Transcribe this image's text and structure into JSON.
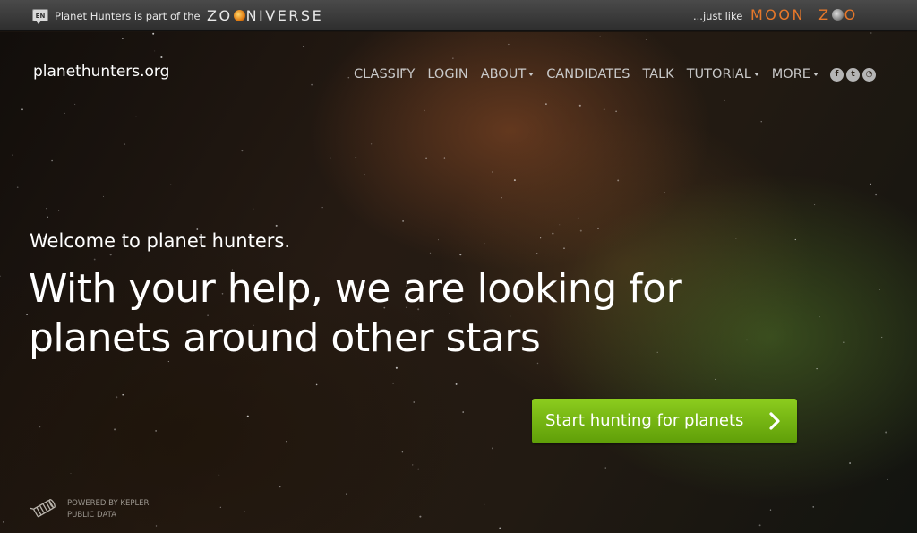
{
  "zooniverse_bar": {
    "language": "EN",
    "part_of_text": "Planet Hunters is part of the",
    "zooniverse_logo": {
      "before": "ZO",
      "after": "NIVERSE"
    },
    "just_like_text": "...just like",
    "moon_zoo_logo": {
      "first": "MOON",
      "second_a": "Z",
      "second_b": "O"
    }
  },
  "header": {
    "site_name": "planethunters.org",
    "nav": [
      {
        "label": "CLASSIFY",
        "dropdown": false
      },
      {
        "label": "LOGIN",
        "dropdown": false
      },
      {
        "label": "ABOUT",
        "dropdown": true
      },
      {
        "label": "CANDIDATES",
        "dropdown": false
      },
      {
        "label": "TALK",
        "dropdown": false
      },
      {
        "label": "TUTORIAL",
        "dropdown": true
      },
      {
        "label": "MORE",
        "dropdown": true
      }
    ],
    "social": [
      {
        "icon": "facebook-icon",
        "glyph": "f"
      },
      {
        "icon": "twitter-icon",
        "glyph": "t"
      },
      {
        "icon": "rss-icon",
        "glyph": "◔"
      }
    ]
  },
  "hero": {
    "welcome": "Welcome to planet hunters.",
    "headline_line1": "With your help, we are looking for",
    "headline_line2": "planets around other stars",
    "cta_label": "Start hunting for planets"
  },
  "footer": {
    "kepler_line1": "POWERED BY KEPLER",
    "kepler_line2": "PUBLIC DATA"
  },
  "colors": {
    "cta_green": "#7ab914",
    "moon_zoo_orange": "#e8782a",
    "nav_text": "#c9c9c9"
  }
}
